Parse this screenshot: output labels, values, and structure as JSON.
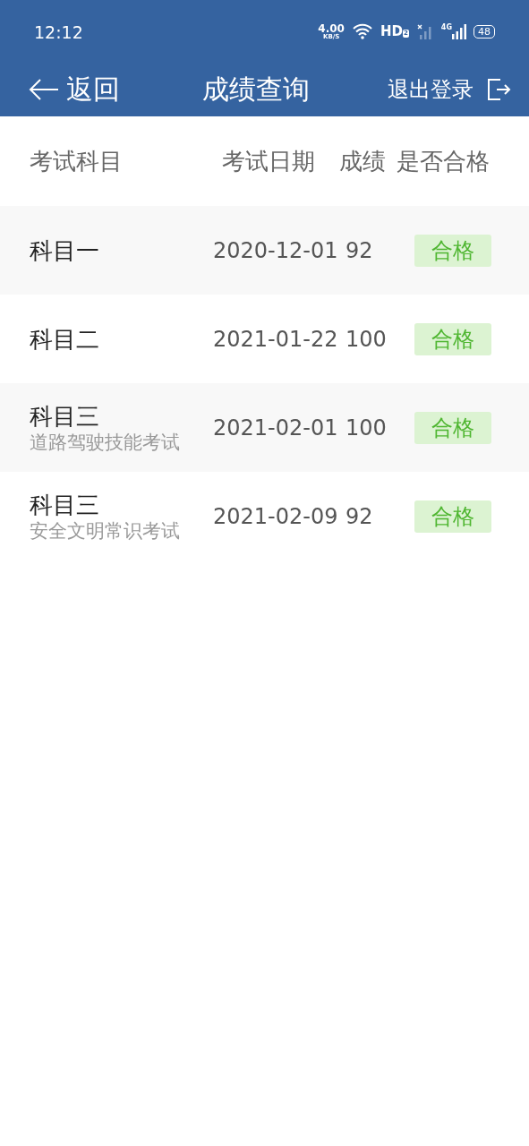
{
  "status_bar": {
    "time": "12:12",
    "speed": "4.00",
    "speed_unit": "KB/S",
    "hd": "HD",
    "hd_sub": "2",
    "network": "4G",
    "battery": "48"
  },
  "header": {
    "back_label": "返回",
    "title": "成绩查询",
    "logout_label": "退出登录"
  },
  "table": {
    "columns": [
      "考试科目",
      "考试日期",
      "成绩",
      "是否合格"
    ],
    "rows": [
      {
        "subject": "科目一",
        "date": "2020-12-01",
        "score": "92",
        "result": "合格",
        "kind": "pass"
      },
      {
        "subject": "科目二",
        "date": "2021-01-22",
        "score": "100",
        "result": "合格",
        "kind": "pass"
      },
      {
        "subject": "科目三",
        "note": "道路驾驶技能考试",
        "date": "2021-02-01",
        "score": "100",
        "result": "合格",
        "kind": "pass"
      },
      {
        "subject": "科目三",
        "note": "安全文明常识考试",
        "date": "2021-02-09",
        "score": "92",
        "result": "合格",
        "kind": "pass"
      }
    ]
  }
}
